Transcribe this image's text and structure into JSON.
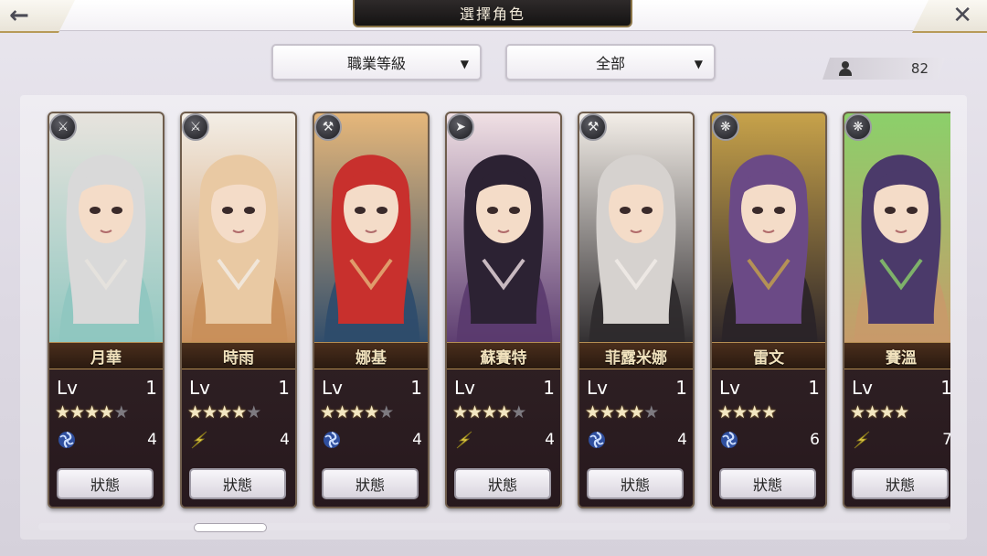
{
  "header": {
    "title": "選擇角色",
    "back_icon": "arrow-left-icon",
    "close_icon": "close-icon"
  },
  "filters": {
    "class_level": "職業等級",
    "scope": "全部"
  },
  "character_count": "82",
  "level_label": "Lv",
  "status_label": "狀態",
  "characters": [
    {
      "name": "月華",
      "level": "1",
      "stars": 4,
      "max_stars": 5,
      "element": "vortex",
      "value": "4",
      "class_icon": "blade-icon",
      "palette": [
        "#d9d9d9",
        "#8fc7c0",
        "#e7e3dd"
      ]
    },
    {
      "name": "時雨",
      "level": "1",
      "stars": 4,
      "max_stars": 5,
      "element": "lightning",
      "value": "4",
      "class_icon": "blade-icon",
      "palette": [
        "#e9c9a3",
        "#c98f5a",
        "#f3eee6"
      ]
    },
    {
      "name": "娜基",
      "level": "1",
      "stars": 4,
      "max_stars": 5,
      "element": "vortex",
      "value": "4",
      "class_icon": "hammer-icon",
      "palette": [
        "#c8302d",
        "#2d4b6b",
        "#e6b77a"
      ]
    },
    {
      "name": "蘇賽特",
      "level": "1",
      "stars": 4,
      "max_stars": 5,
      "element": "lightning",
      "value": "4",
      "class_icon": "lance-icon",
      "palette": [
        "#2c2233",
        "#5a3a6e",
        "#f0e0e4"
      ]
    },
    {
      "name": "菲露米娜",
      "level": "1",
      "stars": 4,
      "max_stars": 5,
      "element": "vortex",
      "value": "4",
      "class_icon": "hammer-icon",
      "palette": [
        "#d6d2cf",
        "#2d2a2c",
        "#f3eee8"
      ]
    },
    {
      "name": "雷文",
      "level": "1",
      "stars": 4,
      "max_stars": 4,
      "element": "vortex",
      "value": "6",
      "class_icon": "hook-icon",
      "palette": [
        "#6b4a86",
        "#2a2328",
        "#c7a24a"
      ]
    },
    {
      "name": "賽溫",
      "level": "1",
      "stars": 4,
      "max_stars": 4,
      "element": "lightning",
      "value": "7",
      "class_icon": "hook-icon",
      "palette": [
        "#4b3a6a",
        "#c89a6a",
        "#8bd06a"
      ]
    }
  ]
}
